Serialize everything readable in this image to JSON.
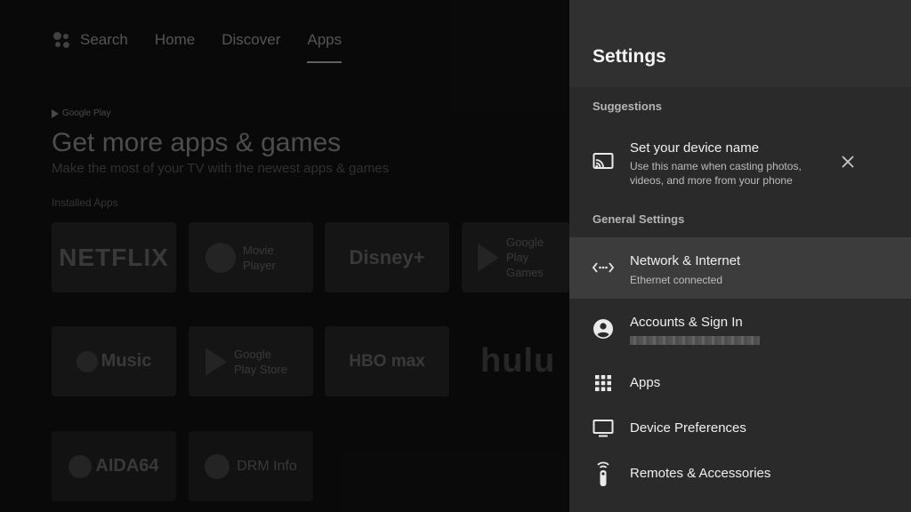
{
  "launcher": {
    "nav": {
      "search": "Search",
      "home": "Home",
      "discover": "Discover",
      "apps": "Apps"
    },
    "google_play_badge": "Google Play",
    "promo_title": "Get more apps & games",
    "promo_subtitle": "Make the most of your TV with the newest apps & games",
    "installed_label": "Installed Apps",
    "tiles": {
      "netflix": "NETFLIX",
      "movie_player": "Movie Player",
      "disney": "Disney+",
      "play_games": "Google Play Games",
      "music": "Music",
      "play_store": "Google Play Store",
      "hbomax": "HBO max",
      "hulu": "hulu",
      "aida64": "AIDA64",
      "drm_info": "DRM Info"
    }
  },
  "settings": {
    "title": "Settings",
    "suggestions_label": "Suggestions",
    "suggestion": {
      "title": "Set your device name",
      "subtitle": "Use this name when casting photos, videos, and more from your phone",
      "icon": "cast-icon"
    },
    "general_label": "General Settings",
    "items": [
      {
        "label": "Network & Internet",
        "sub": "Ethernet connected",
        "icon": "network-icon",
        "focused": true
      },
      {
        "label": "Accounts & Sign In",
        "sub": "",
        "icon": "account-icon"
      },
      {
        "label": "Apps",
        "sub": "",
        "icon": "apps-grid-icon"
      },
      {
        "label": "Device Preferences",
        "sub": "",
        "icon": "tv-icon"
      },
      {
        "label": "Remotes & Accessories",
        "sub": "",
        "icon": "remote-icon"
      }
    ]
  },
  "colors": {
    "panel_bg": "#2a2a2a",
    "header_bg": "#303030",
    "focused_row": "#3c3c3c"
  }
}
